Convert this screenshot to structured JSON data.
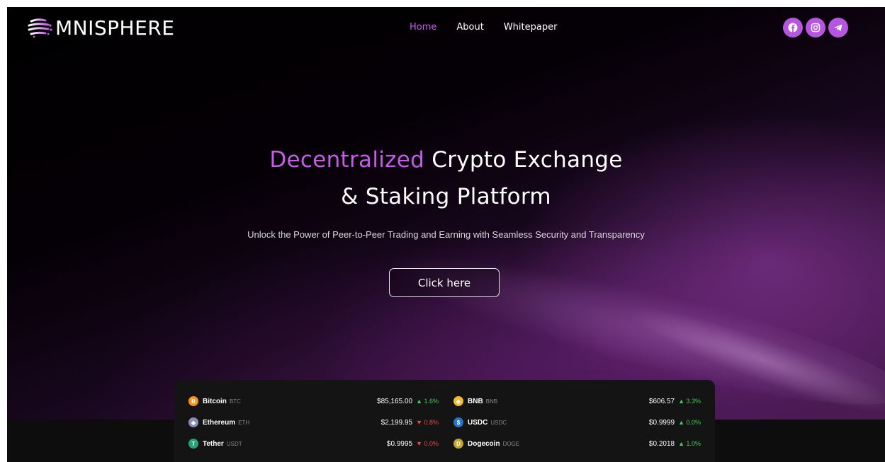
{
  "brand": {
    "name": "MNISPHERE"
  },
  "nav": {
    "items": [
      {
        "label": "Home",
        "active": true
      },
      {
        "label": "About",
        "active": false
      },
      {
        "label": "Whitepaper",
        "active": false
      }
    ]
  },
  "socials": [
    {
      "icon": "facebook-icon"
    },
    {
      "icon": "instagram-icon"
    },
    {
      "icon": "telegram-icon"
    }
  ],
  "hero": {
    "title_accent": "Decentralized",
    "title_rest": " Crypto Exchange",
    "title_line2": "& Staking Platform",
    "subtitle": "Unlock the Power of Peer-to-Peer Trading and Earning with Seamless Security and Transparency",
    "cta_label": "Click here"
  },
  "colors": {
    "accent": "#c45ce6",
    "social_bg": "#b655e0",
    "up": "#3ecf5a",
    "down": "#e64a4a"
  },
  "ticker": {
    "left": [
      {
        "name": "Bitcoin",
        "symbol": "BTC",
        "price": "$85,165.00",
        "change": "1.6%",
        "dir": "up",
        "icon": "bitcoin-icon",
        "icon_color": "#f7931a",
        "glyph": "B"
      },
      {
        "name": "Ethereum",
        "symbol": "ETH",
        "price": "$2,199.95",
        "change": "0.8%",
        "dir": "down",
        "icon": "ethereum-icon",
        "icon_color": "#8a8fb8",
        "glyph": "◆"
      },
      {
        "name": "Tether",
        "symbol": "USDT",
        "price": "$0.9995",
        "change": "0.0%",
        "dir": "down",
        "icon": "tether-icon",
        "icon_color": "#26a17b",
        "glyph": "T"
      }
    ],
    "right": [
      {
        "name": "BNB",
        "symbol": "BNB",
        "price": "$606.57",
        "change": "3.3%",
        "dir": "up",
        "icon": "bnb-icon",
        "icon_color": "#f3ba2f",
        "glyph": "◈"
      },
      {
        "name": "USDC",
        "symbol": "USDC",
        "price": "$0.9999",
        "change": "0.0%",
        "dir": "up",
        "icon": "usdc-icon",
        "icon_color": "#2775ca",
        "glyph": "$"
      },
      {
        "name": "Dogecoin",
        "symbol": "DOGE",
        "price": "$0.2018",
        "change": "1.0%",
        "dir": "up",
        "icon": "dogecoin-icon",
        "icon_color": "#c2a633",
        "glyph": "D"
      }
    ]
  }
}
